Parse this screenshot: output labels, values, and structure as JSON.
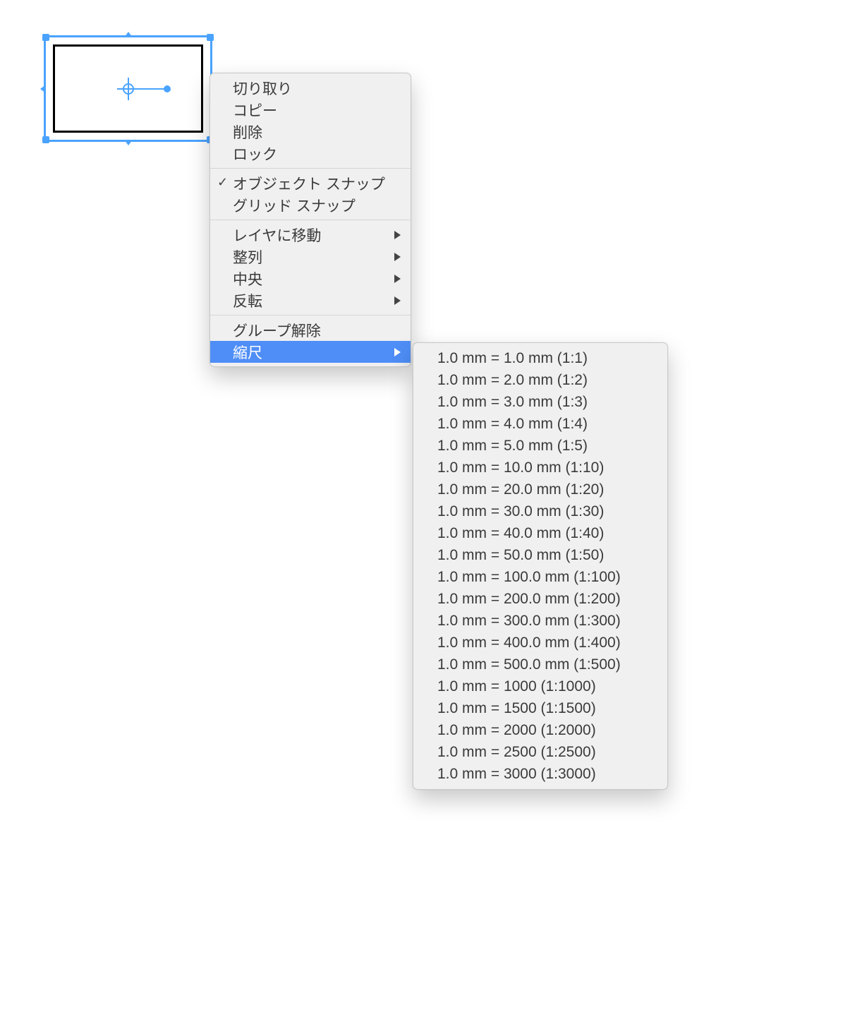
{
  "context_menu": {
    "groups": [
      [
        {
          "key": "cut",
          "label": "切り取り"
        },
        {
          "key": "copy",
          "label": "コピー"
        },
        {
          "key": "delete",
          "label": "削除"
        },
        {
          "key": "lock",
          "label": "ロック"
        }
      ],
      [
        {
          "key": "object-snap",
          "label": "オブジェクト スナップ",
          "checked": true
        },
        {
          "key": "grid-snap",
          "label": "グリッド スナップ"
        }
      ],
      [
        {
          "key": "move-layer",
          "label": "レイヤに移動",
          "submenu": true
        },
        {
          "key": "align",
          "label": "整列",
          "submenu": true
        },
        {
          "key": "center",
          "label": "中央",
          "submenu": true
        },
        {
          "key": "flip",
          "label": "反転",
          "submenu": true
        }
      ],
      [
        {
          "key": "ungroup",
          "label": "グループ解除"
        },
        {
          "key": "scale",
          "label": "縮尺",
          "submenu": true,
          "highlighted": true
        }
      ]
    ]
  },
  "scale_submenu": {
    "items": [
      "1.0 mm = 1.0 mm (1:1)",
      "1.0 mm = 2.0 mm (1:2)",
      "1.0 mm = 3.0 mm (1:3)",
      "1.0 mm = 4.0 mm (1:4)",
      "1.0 mm = 5.0 mm (1:5)",
      "1.0 mm = 10.0 mm (1:10)",
      "1.0 mm = 20.0 mm (1:20)",
      "1.0 mm = 30.0 mm (1:30)",
      "1.0 mm = 40.0 mm (1:40)",
      "1.0 mm = 50.0 mm (1:50)",
      "1.0 mm = 100.0 mm (1:100)",
      "1.0 mm = 200.0 mm (1:200)",
      "1.0 mm = 300.0 mm (1:300)",
      "1.0 mm = 400.0 mm (1:400)",
      "1.0 mm = 500.0 mm (1:500)",
      "1.0 mm = 1000 (1:1000)",
      "1.0 mm = 1500 (1:1500)",
      "1.0 mm = 2000 (1:2000)",
      "1.0 mm = 2500 (1:2500)",
      "1.0 mm = 3000 (1:3000)"
    ]
  }
}
